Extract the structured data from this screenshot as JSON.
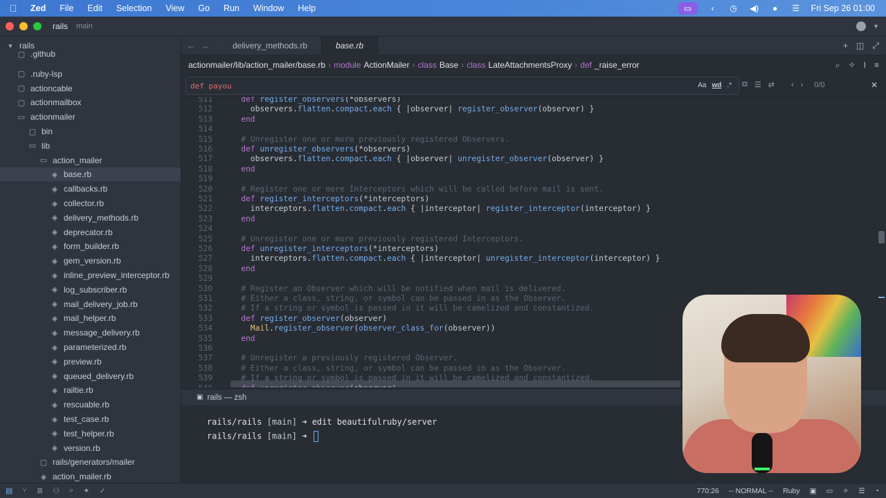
{
  "menubar": {
    "app_name": "Zed",
    "items": [
      "File",
      "Edit",
      "Selection",
      "View",
      "Go",
      "Run",
      "Window",
      "Help"
    ],
    "clock": "Fri Sep 26  01:00"
  },
  "titlebar": {
    "project": "rails",
    "branch": "main"
  },
  "sidebar": {
    "items": [
      {
        "label": "rails",
        "icon": "chevron-down-icon",
        "indent": 0
      },
      {
        "label": ".github",
        "icon": "folder-icon",
        "indent": 1
      },
      {
        "label": ".ruby-lsp",
        "icon": "folder-icon",
        "indent": 1
      },
      {
        "label": "actioncable",
        "icon": "folder-icon",
        "indent": 1
      },
      {
        "label": "actionmailbox",
        "icon": "folder-icon",
        "indent": 1
      },
      {
        "label": "actionmailer",
        "icon": "folder-open-icon",
        "indent": 1
      },
      {
        "label": "bin",
        "icon": "folder-icon",
        "indent": 2
      },
      {
        "label": "lib",
        "icon": "folder-open-icon",
        "indent": 2
      },
      {
        "label": "action_mailer",
        "icon": "folder-open-icon",
        "indent": 3
      },
      {
        "label": "base.rb",
        "icon": "ruby-file-icon",
        "indent": 4,
        "selected": true
      },
      {
        "label": "callbacks.rb",
        "icon": "ruby-file-icon",
        "indent": 4
      },
      {
        "label": "collector.rb",
        "icon": "ruby-file-icon",
        "indent": 4
      },
      {
        "label": "delivery_methods.rb",
        "icon": "ruby-file-icon",
        "indent": 4
      },
      {
        "label": "deprecator.rb",
        "icon": "ruby-file-icon",
        "indent": 4
      },
      {
        "label": "form_builder.rb",
        "icon": "ruby-file-icon",
        "indent": 4
      },
      {
        "label": "gem_version.rb",
        "icon": "ruby-file-icon",
        "indent": 4
      },
      {
        "label": "inline_preview_interceptor.rb",
        "icon": "ruby-file-icon",
        "indent": 4
      },
      {
        "label": "log_subscriber.rb",
        "icon": "ruby-file-icon",
        "indent": 4
      },
      {
        "label": "mail_delivery_job.rb",
        "icon": "ruby-file-icon",
        "indent": 4
      },
      {
        "label": "mail_helper.rb",
        "icon": "ruby-file-icon",
        "indent": 4
      },
      {
        "label": "message_delivery.rb",
        "icon": "ruby-file-icon",
        "indent": 4
      },
      {
        "label": "parameterized.rb",
        "icon": "ruby-file-icon",
        "indent": 4
      },
      {
        "label": "preview.rb",
        "icon": "ruby-file-icon",
        "indent": 4
      },
      {
        "label": "queued_delivery.rb",
        "icon": "ruby-file-icon",
        "indent": 4
      },
      {
        "label": "railtie.rb",
        "icon": "ruby-file-icon",
        "indent": 4
      },
      {
        "label": "rescuable.rb",
        "icon": "ruby-file-icon",
        "indent": 4
      },
      {
        "label": "test_case.rb",
        "icon": "ruby-file-icon",
        "indent": 4
      },
      {
        "label": "test_helper.rb",
        "icon": "ruby-file-icon",
        "indent": 4
      },
      {
        "label": "version.rb",
        "icon": "ruby-file-icon",
        "indent": 4
      },
      {
        "label": "rails/generators/mailer",
        "icon": "folder-icon",
        "indent": 3
      },
      {
        "label": "action_mailer.rb",
        "icon": "ruby-file-icon",
        "indent": 3
      }
    ]
  },
  "tabs": [
    {
      "label": "delivery_methods.rb",
      "active": false
    },
    {
      "label": "base.rb",
      "active": true
    }
  ],
  "breadcrumb": {
    "path": "actionmailer/lib/action_mailer/base.rb",
    "symbols": [
      {
        "kw": "module",
        "name": "ActionMailer"
      },
      {
        "kw": "class",
        "name": "Base"
      },
      {
        "kw": "class",
        "name": "LateAttachmentsProxy"
      },
      {
        "kw": "def",
        "name": "_raise_error"
      }
    ]
  },
  "search": {
    "value": "def payou",
    "options": [
      "Aa",
      "wd",
      ".*"
    ],
    "match_count": "0/0"
  },
  "code": {
    "lines": [
      {
        "n": "511",
        "segs": [
          [
            "kw",
            "    def "
          ],
          [
            "fn",
            "register_observers"
          ],
          [
            "plain",
            "(*observers)"
          ]
        ]
      },
      {
        "n": "512",
        "segs": [
          [
            "plain",
            "      observers."
          ],
          [
            "fn",
            "flatten"
          ],
          [
            "plain",
            "."
          ],
          [
            "fn",
            "compact"
          ],
          [
            "plain",
            "."
          ],
          [
            "fn",
            "each"
          ],
          [
            "plain",
            " { |observer| "
          ],
          [
            "fn",
            "register_observer"
          ],
          [
            "plain",
            "(observer) }"
          ]
        ]
      },
      {
        "n": "513",
        "segs": [
          [
            "kw",
            "    end"
          ]
        ]
      },
      {
        "n": "514",
        "segs": [
          [
            "plain",
            ""
          ]
        ]
      },
      {
        "n": "515",
        "segs": [
          [
            "comment",
            "    # Unregister one or more previously registered Observers."
          ]
        ]
      },
      {
        "n": "516",
        "segs": [
          [
            "kw",
            "    def "
          ],
          [
            "fn",
            "unregister_observers"
          ],
          [
            "plain",
            "(*observers)"
          ]
        ]
      },
      {
        "n": "517",
        "segs": [
          [
            "plain",
            "      observers."
          ],
          [
            "fn",
            "flatten"
          ],
          [
            "plain",
            "."
          ],
          [
            "fn",
            "compact"
          ],
          [
            "plain",
            "."
          ],
          [
            "fn",
            "each"
          ],
          [
            "plain",
            " { |observer| "
          ],
          [
            "fn",
            "unregister_observer"
          ],
          [
            "plain",
            "(observer) }"
          ]
        ]
      },
      {
        "n": "518",
        "segs": [
          [
            "kw",
            "    end"
          ]
        ]
      },
      {
        "n": "519",
        "segs": [
          [
            "plain",
            ""
          ]
        ]
      },
      {
        "n": "520",
        "segs": [
          [
            "comment",
            "    # Register one or more Interceptors which will be called before mail is sent."
          ]
        ]
      },
      {
        "n": "521",
        "segs": [
          [
            "kw",
            "    def "
          ],
          [
            "fn",
            "register_interceptors"
          ],
          [
            "plain",
            "(*interceptors)"
          ]
        ]
      },
      {
        "n": "522",
        "segs": [
          [
            "plain",
            "      interceptors."
          ],
          [
            "fn",
            "flatten"
          ],
          [
            "plain",
            "."
          ],
          [
            "fn",
            "compact"
          ],
          [
            "plain",
            "."
          ],
          [
            "fn",
            "each"
          ],
          [
            "plain",
            " { |interceptor| "
          ],
          [
            "fn",
            "register_interceptor"
          ],
          [
            "plain",
            "(interceptor) }"
          ]
        ]
      },
      {
        "n": "523",
        "segs": [
          [
            "kw",
            "    end"
          ]
        ]
      },
      {
        "n": "524",
        "segs": [
          [
            "plain",
            ""
          ]
        ]
      },
      {
        "n": "525",
        "segs": [
          [
            "comment",
            "    # Unregister one or more previously registered Interceptors."
          ]
        ]
      },
      {
        "n": "526",
        "segs": [
          [
            "kw",
            "    def "
          ],
          [
            "fn",
            "unregister_interceptors"
          ],
          [
            "plain",
            "(*interceptors)"
          ]
        ]
      },
      {
        "n": "527",
        "segs": [
          [
            "plain",
            "      interceptors."
          ],
          [
            "fn",
            "flatten"
          ],
          [
            "plain",
            "."
          ],
          [
            "fn",
            "compact"
          ],
          [
            "plain",
            "."
          ],
          [
            "fn",
            "each"
          ],
          [
            "plain",
            " { |interceptor| "
          ],
          [
            "fn",
            "unregister_interceptor"
          ],
          [
            "plain",
            "(interceptor) }"
          ]
        ]
      },
      {
        "n": "528",
        "segs": [
          [
            "kw",
            "    end"
          ]
        ]
      },
      {
        "n": "529",
        "segs": [
          [
            "plain",
            ""
          ]
        ]
      },
      {
        "n": "530",
        "segs": [
          [
            "comment",
            "    # Register an Observer which will be notified when mail is delivered."
          ]
        ]
      },
      {
        "n": "531",
        "segs": [
          [
            "comment",
            "    # Either a class, string, or symbol can be passed in as the Observer."
          ]
        ]
      },
      {
        "n": "532",
        "segs": [
          [
            "comment",
            "    # If a string or symbol is passed in it will be camelized and constantized."
          ]
        ]
      },
      {
        "n": "533",
        "segs": [
          [
            "kw",
            "    def "
          ],
          [
            "fn",
            "register_observer"
          ],
          [
            "plain",
            "(observer)"
          ]
        ]
      },
      {
        "n": "534",
        "segs": [
          [
            "const",
            "      Mail"
          ],
          [
            "plain",
            "."
          ],
          [
            "fn",
            "register_observer"
          ],
          [
            "plain",
            "("
          ],
          [
            "fn",
            "observer_class_for"
          ],
          [
            "plain",
            "(observer))"
          ]
        ]
      },
      {
        "n": "535",
        "segs": [
          [
            "kw",
            "    end"
          ]
        ]
      },
      {
        "n": "536",
        "segs": [
          [
            "plain",
            ""
          ]
        ]
      },
      {
        "n": "537",
        "segs": [
          [
            "comment",
            "    # Unregister a previously registered Observer."
          ]
        ]
      },
      {
        "n": "538",
        "segs": [
          [
            "comment",
            "    # Either a class, string, or symbol can be passed in as the Observer."
          ]
        ]
      },
      {
        "n": "539",
        "segs": [
          [
            "comment",
            "    # If a string or symbol is passed in it will be camelized and constantized."
          ]
        ]
      },
      {
        "n": "540",
        "segs": [
          [
            "kw",
            "    def "
          ],
          [
            "fn",
            "unregister_observer"
          ],
          [
            "plain",
            "(observer)"
          ]
        ]
      }
    ]
  },
  "terminal": {
    "tab_label": "rails — zsh",
    "lines": [
      {
        "prompt": "rails/rails",
        "branch": "[main]",
        "arrow": "➜",
        "cmd": "edit beautifulruby/server"
      },
      {
        "prompt": "rails/rails",
        "branch": "[main]",
        "arrow": "➜",
        "cmd": ""
      }
    ]
  },
  "statusbar": {
    "position": "770:26",
    "mode": "-- NORMAL --",
    "language": "Ruby"
  }
}
